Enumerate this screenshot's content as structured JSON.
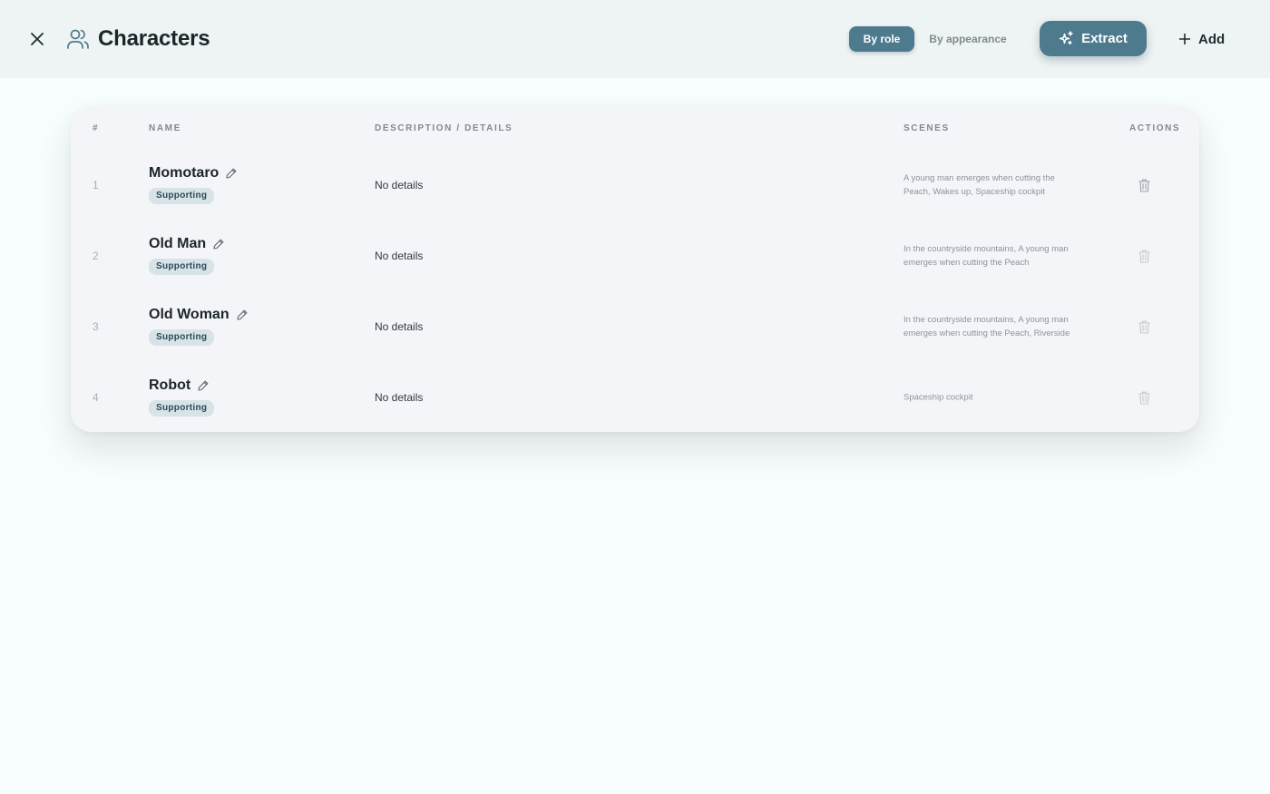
{
  "header": {
    "title": "Characters",
    "view_toggle": {
      "active": "By role",
      "inactive": "By appearance"
    },
    "extract_label": "Extract",
    "add_label": "Add"
  },
  "table": {
    "headers": [
      "#",
      "NAME",
      "DESCRIPTION / DETAILS",
      "SCENES",
      "ACTIONS"
    ],
    "rows": [
      {
        "num": "1",
        "name": "Momotaro",
        "role": "Supporting",
        "details": "No details",
        "scenes": "A young man emerges when cutting the Peach, Wakes up, Spaceship cockpit"
      },
      {
        "num": "2",
        "name": "Old Man",
        "role": "Supporting",
        "details": "No details",
        "scenes": "In the countryside mountains, A young man emerges when cutting the Peach"
      },
      {
        "num": "3",
        "name": "Old Woman",
        "role": "Supporting",
        "details": "No details",
        "scenes": "In the countryside mountains, A young man emerges when cutting the Peach, Riverside"
      },
      {
        "num": "4",
        "name": "Robot",
        "role": "Supporting",
        "details": "No details",
        "scenes": "Spaceship cockpit"
      }
    ]
  },
  "icons": {
    "close": "close-icon",
    "title": "users-icon",
    "extract": "sparkles-icon",
    "add": "plus-icon",
    "edit": "pencil-icon",
    "delete": "trash-icon"
  },
  "colors": {
    "accent": "#4e7a8e",
    "header_bg": "#eef4f4",
    "badge_bg": "#d7e3e6",
    "page_bg": "#f8fdfd"
  }
}
